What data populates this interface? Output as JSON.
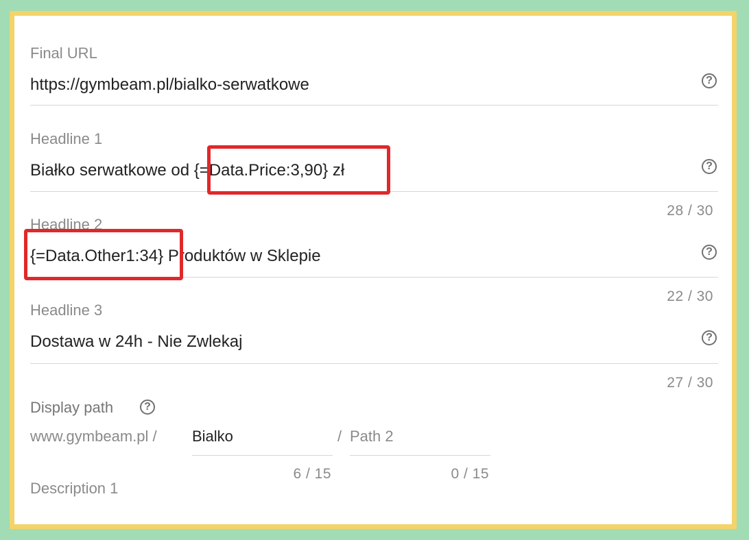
{
  "final_url": {
    "label": "Final URL",
    "value": "https://gymbeam.pl/bialko-serwatkowe",
    "help_icon": "question-circle-icon"
  },
  "headline1": {
    "label": "Headline 1",
    "value_prefix": "Białko serwatkowe od ",
    "value_param": "{=Data.Price:3,90}",
    "value_suffix": " zł",
    "counter": "28 / 30"
  },
  "headline2": {
    "label": "Headline 2",
    "value_param": "{=Data.Other1:34}",
    "value_suffix": " Produktów w Sklepie",
    "counter": "22 / 30"
  },
  "headline3": {
    "label": "Headline 3",
    "value": "Dostawa w 24h - Nie Zwlekaj",
    "counter": "27 / 30"
  },
  "display_path": {
    "label": "Display path",
    "domain": "www.gymbeam.pl /",
    "path1_value": "Bialko",
    "separator": "/",
    "path2_placeholder": "Path 2",
    "path1_counter": "6 / 15",
    "path2_counter": "0 / 15"
  },
  "description1": {
    "label": "Description 1"
  },
  "colors": {
    "highlight": "#e0282a",
    "frame_border": "#f3d36a",
    "outer_background": "#a2dcb4"
  }
}
